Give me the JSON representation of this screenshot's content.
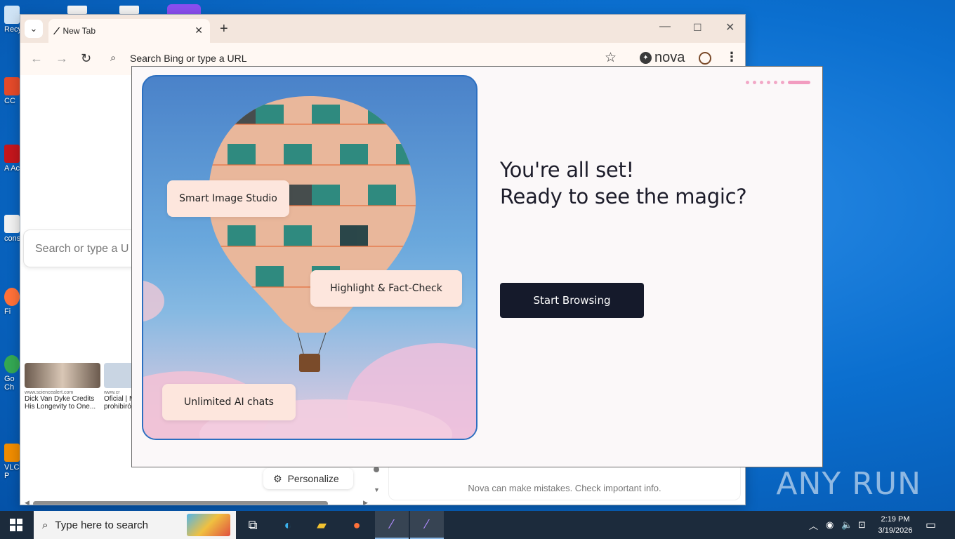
{
  "desktop": {
    "icons": [
      {
        "label": "Recy"
      },
      {
        "label": "CC"
      },
      {
        "label": "A Ac"
      },
      {
        "label": "cons"
      },
      {
        "label": "Fi"
      },
      {
        "label": "Go Ch"
      },
      {
        "label": "VLC P"
      }
    ],
    "watermark": "ANY RUN"
  },
  "browser": {
    "tab_title": "New Tab",
    "address_placeholder": "Search Bing or type a URL",
    "brand_name": "nova",
    "ntp": {
      "search_placeholder": "Search or type a U",
      "news": [
        {
          "source": "www.sciencealert.com",
          "title": "Dick Van Dyke Credits His Longevity to One..."
        },
        {
          "source": "www.cr",
          "title": "Oficial | M prohibiró"
        }
      ],
      "personalize_label": "Personalize",
      "disclaimer": "Nova can make mistakes. Check important info."
    }
  },
  "onboarding": {
    "headline_line1": "You're all set!",
    "headline_line2": "Ready to see the magic?",
    "cta_label": "Start Browsing",
    "features": [
      "Smart Image Studio",
      "Highlight & Fact-Check",
      "Unlimited AI chats"
    ]
  },
  "taskbar": {
    "search_placeholder": "Type here to search",
    "time": "2:19 PM",
    "date": "3/19/2026"
  },
  "colors": {
    "cta_background": "#151a2b",
    "chip_background": "#fde6dd",
    "progress_accent": "#f29cc0"
  }
}
